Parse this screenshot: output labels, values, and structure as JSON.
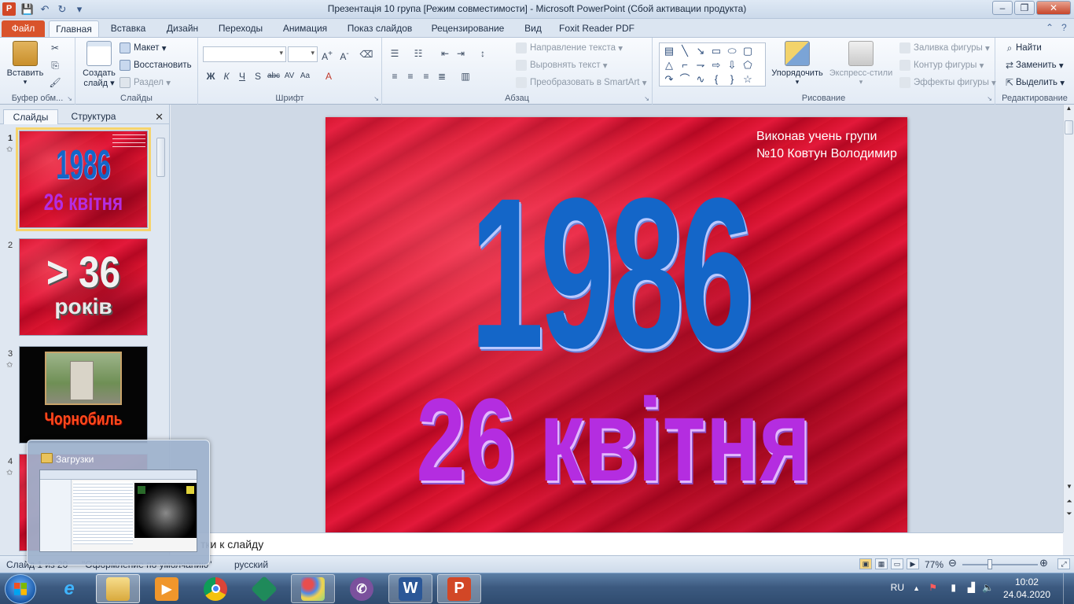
{
  "window": {
    "title": "Презентація 10 група [Режим совместимости]  -  Microsoft PowerPoint (Сбой активации продукта)",
    "app_icon": "P"
  },
  "tabs": [
    "Файл",
    "Главная",
    "Вставка",
    "Дизайн",
    "Переходы",
    "Анимация",
    "Показ слайдов",
    "Рецензирование",
    "Вид",
    "Foxit Reader PDF"
  ],
  "ribbon": {
    "clipboard": {
      "label": "Буфер обм...",
      "paste": "Вставить"
    },
    "slides": {
      "label": "Слайды",
      "new_slide_1": "Создать",
      "new_slide_2": "слайд",
      "layout": "Макет",
      "reset": "Восстановить",
      "section": "Раздел"
    },
    "font": {
      "label": "Шрифт"
    },
    "paragraph": {
      "label": "Абзац",
      "text_direction": "Направление текста",
      "align_text": "Выровнять текст",
      "smartart": "Преобразовать в SmartArt"
    },
    "drawing": {
      "label": "Рисование",
      "arrange": "Упорядочить",
      "quick_styles": "Экспресс-стили",
      "shape_fill": "Заливка фигуры",
      "shape_outline": "Контур фигуры",
      "shape_effects": "Эффекты фигуры"
    },
    "editing": {
      "label": "Редактирование",
      "find": "Найти",
      "replace": "Заменить",
      "select": "Выделить"
    }
  },
  "left_panel": {
    "tabs": [
      "Слайды",
      "Структура"
    ],
    "thumbnails": [
      {
        "number": "1",
        "year": "1986",
        "date": "26 квітня"
      },
      {
        "number": "2",
        "big": "> 36",
        "sub": "років"
      },
      {
        "number": "3",
        "caption": "Чорнобиль"
      },
      {
        "number": "4"
      }
    ]
  },
  "slide": {
    "author": "Виконав учень групи №10 Ковтун Володимир",
    "year": "1986",
    "date": "26  квітня"
  },
  "notes": {
    "placeholder_visible": "тки к слайду"
  },
  "statusbar": {
    "slide_info": "Слайд 1 из 20",
    "theme": "\"Оформление по умолчанию\"",
    "language": "русский",
    "zoom": "77%"
  },
  "taskbar": {
    "preview_title": "Загрузки",
    "language": "RU",
    "time": "10:02",
    "date": "24.04.2020"
  },
  "colors": {
    "slide_red": "#d8142f",
    "year_blue": "#1466c8",
    "date_purple": "#b42de0",
    "file_tab": "#d9532b"
  }
}
